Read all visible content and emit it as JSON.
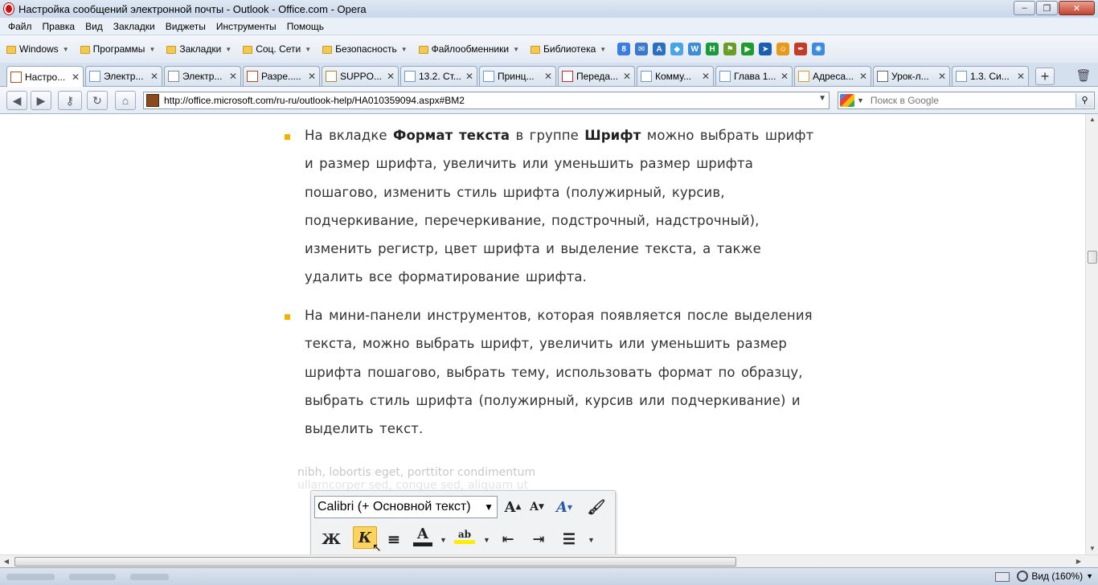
{
  "window": {
    "title": "Настройка сообщений электронной почты - Outlook - Office.com - Opera",
    "buttons": [
      "‒",
      "❐",
      "✕"
    ]
  },
  "menu": [
    "Файл",
    "Правка",
    "Вид",
    "Закладки",
    "Виджеты",
    "Инструменты",
    "Помощь"
  ],
  "bookmarks": {
    "folders": [
      "Windows",
      "Программы",
      "Закладки",
      "Соц. Сети",
      "Безопасность",
      "Файлообменники",
      "Библиотека"
    ],
    "icons": [
      {
        "name": "google-icon",
        "glyph": "8",
        "color": "#3a7de0"
      },
      {
        "name": "mail-icon",
        "glyph": "✉",
        "color": "#3d79c9"
      },
      {
        "name": "translate-icon",
        "glyph": "A",
        "color": "#2a6fc0"
      },
      {
        "name": "drop-icon",
        "glyph": "◆",
        "color": "#4aa5e8"
      },
      {
        "name": "w-icon",
        "glyph": "W",
        "color": "#3b8dd8"
      },
      {
        "name": "h-icon",
        "glyph": "H",
        "color": "#1a9a3b"
      },
      {
        "name": "flag-icon",
        "glyph": "⚑",
        "color": "#6a9c28"
      },
      {
        "name": "play-icon",
        "glyph": "▶",
        "color": "#1f9c2e"
      },
      {
        "name": "arrow-icon",
        "glyph": "➤",
        "color": "#1c5fb0"
      },
      {
        "name": "smile-icon",
        "glyph": "☺",
        "color": "#e69a1c"
      },
      {
        "name": "pen-icon",
        "glyph": "✒",
        "color": "#c23c2a"
      },
      {
        "name": "gear-icon",
        "glyph": "✺",
        "color": "#3d8cd9"
      }
    ]
  },
  "tabs": [
    {
      "label": "Настро...",
      "active": true
    },
    {
      "label": "Электр...",
      "active": false
    },
    {
      "label": "Электр...",
      "active": false
    },
    {
      "label": "Разре.....",
      "active": false
    },
    {
      "label": "SUPPO...",
      "active": false
    },
    {
      "label": "13.2. Ст...",
      "active": false
    },
    {
      "label": "Принц...",
      "active": false
    },
    {
      "label": "Переда...",
      "active": false
    },
    {
      "label": "Комму...",
      "active": false
    },
    {
      "label": "Глава 1...",
      "active": false
    },
    {
      "label": "Адреса...",
      "active": false
    },
    {
      "label": "Урок-л...",
      "active": false
    },
    {
      "label": "1.3. Си...",
      "active": false
    }
  ],
  "address": {
    "url": "http://office.microsoft.com/ru-ru/outlook-help/HA010359094.aspx#BM2",
    "search_placeholder": "Поиск в Google"
  },
  "content": {
    "bullet1": {
      "t1": "На вкладке ",
      "b1": "Формат текста",
      "t2": " в группе ",
      "b2": "Шрифт",
      "t3": " можно выбрать шрифт и размер шрифта, увеличить или уменьшить размер шрифта пошагово, изменить стиль шрифта (полужирный, курсив, подчеркивание, перечеркивание, подстрочный, надстрочный), изменить регистр, цвет шрифта и выделение текста, а также удалить все форматирование шрифта."
    },
    "bullet2": "На мини-панели инструментов, которая появляется после выделения текста, можно выбрать шрифт, увеличить или уменьшить размер шрифта пошагово, выбрать тему, использовать формат по образцу, выбрать стиль шрифта (полужирный, курсив или подчеркивание) и выделить текст.",
    "image": {
      "fade_line1": "nibh, lobortis eget, porttitor condimentum",
      "fade_line2": "ullamcorper sed, congue sed, aliquam ut",
      "font_name": "Calibri (+ Основной текст)",
      "grow_glyph": "A",
      "shrink_glyph": "A",
      "bold_glyph": "Ж",
      "italic_glyph": "К",
      "color_glyph": "A",
      "highlight_glyph": "ab"
    }
  },
  "status": {
    "zoom": "Вид (160%)"
  },
  "colors": {
    "bullet": "#f0b400",
    "text": "#333333",
    "font_color_bar": "#1f1f1f",
    "highlight_bar": "#ffee00"
  }
}
